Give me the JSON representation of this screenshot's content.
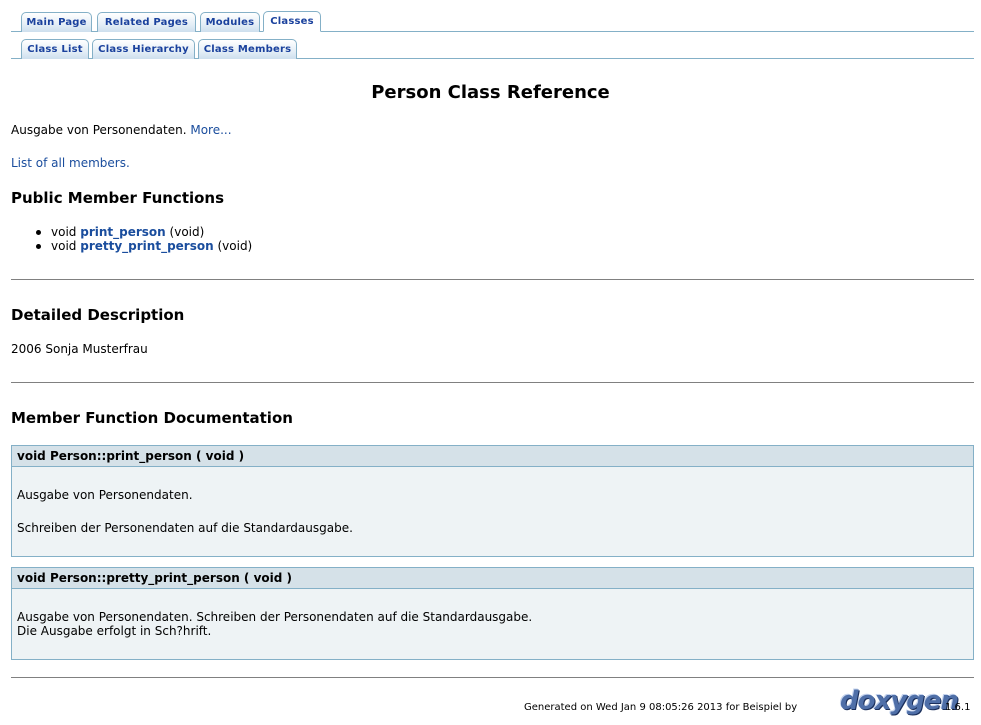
{
  "nav": {
    "tabs": [
      "Main Page",
      "Related Pages",
      "Modules",
      "Classes"
    ],
    "subtabs": [
      "Class List",
      "Class Hierarchy",
      "Class Members"
    ]
  },
  "page": {
    "title": "Person Class Reference",
    "brief": "Ausgabe von Personendaten.",
    "more_link": "More...",
    "all_members_link": "List of all members."
  },
  "public_functions": {
    "heading": "Public Member Functions",
    "items": [
      {
        "ret": "void",
        "name": "print_person",
        "args": "(void)"
      },
      {
        "ret": "void",
        "name": "pretty_print_person",
        "args": "(void)"
      }
    ]
  },
  "detailed": {
    "heading": "Detailed Description",
    "text": "2006 Sonja Musterfrau"
  },
  "member_docs": {
    "heading": "Member Function Documentation",
    "items": [
      {
        "proto": "void Person::print_person ( void    )",
        "lines": [
          "Ausgabe von Personendaten.",
          "Schreiben der Personendaten auf die Standardausgabe."
        ]
      },
      {
        "proto": "void Person::pretty_print_person ( void    )",
        "lines": [
          "Ausgabe von Personendaten. Schreiben der Personendaten auf die Standardausgabe.",
          "Die Ausgabe erfolgt in Sch?hrift."
        ]
      }
    ]
  },
  "footer": {
    "generated": "Generated on Wed Jan 9 08:05:26 2013 for Beispiel by",
    "logo": "doxygen",
    "version": "1.6.1"
  }
}
